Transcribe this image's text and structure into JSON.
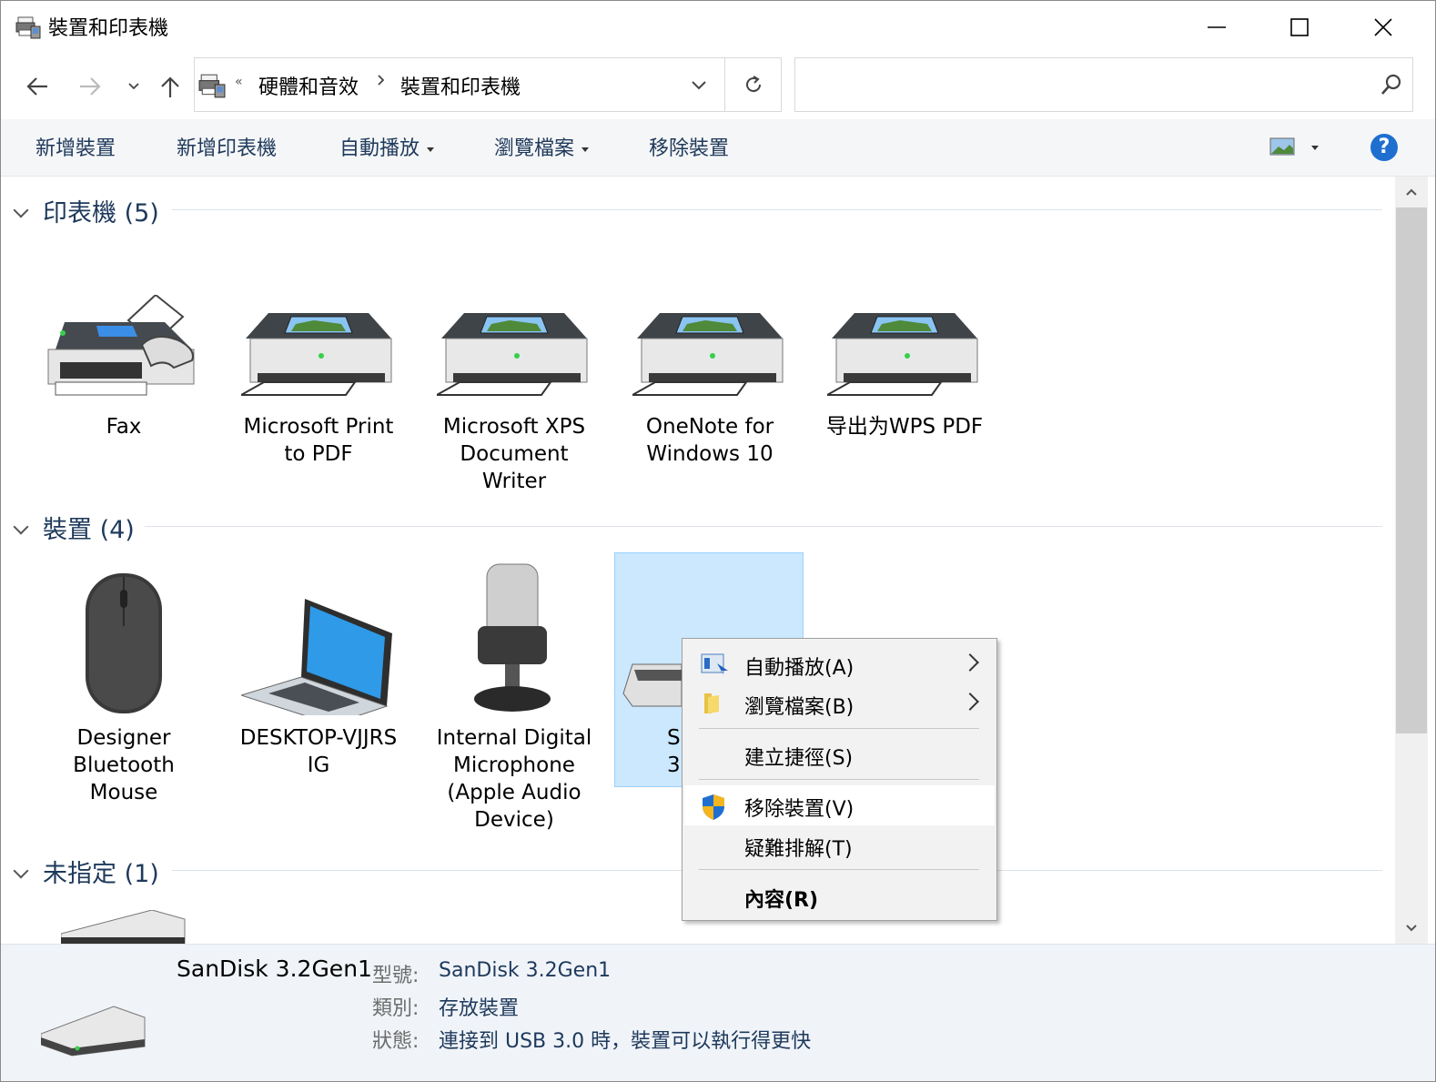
{
  "window": {
    "title": "裝置和印表機"
  },
  "nav": {
    "breadcrumb_prefix": "«",
    "breadcrumb": [
      "硬體和音效",
      "裝置和印表機"
    ],
    "search_placeholder": ""
  },
  "toolbar": {
    "items": [
      {
        "label": "新增裝置"
      },
      {
        "label": "新增印表機"
      },
      {
        "label": "自動播放"
      },
      {
        "label": "瀏覽檔案"
      },
      {
        "label": "移除裝置"
      }
    ],
    "help": "?"
  },
  "groups": {
    "printers": {
      "title": "印表機 (5)"
    },
    "devices": {
      "title": "裝置 (4)"
    },
    "unspecified": {
      "title": "未指定 (1)"
    }
  },
  "printers": [
    {
      "line1": "Fax",
      "line2": "",
      "line3": ""
    },
    {
      "line1": "Microsoft Print",
      "line2": "to PDF",
      "line3": ""
    },
    {
      "line1": "Microsoft XPS",
      "line2": "Document",
      "line3": "Writer"
    },
    {
      "line1": "OneNote for",
      "line2": "Windows 10",
      "line3": ""
    },
    {
      "line1": "导出为WPS PDF",
      "line2": "",
      "line3": ""
    }
  ],
  "devices": [
    {
      "line1": "Designer",
      "line2": "Bluetooth",
      "line3": "Mouse",
      "line4": ""
    },
    {
      "line1": "DESKTOP-VJJRS",
      "line2": "IG",
      "line3": "",
      "line4": ""
    },
    {
      "line1": "Internal Digital",
      "line2": "Microphone",
      "line3": "(Apple Audio",
      "line4": "Device)"
    },
    {
      "line1": "S",
      "line2": "3.",
      "line3": "",
      "line4": ""
    }
  ],
  "context_menu": {
    "items": [
      {
        "label": "自動播放(A)"
      },
      {
        "label": "瀏覽檔案(B)"
      },
      {
        "label": "建立捷徑(S)"
      },
      {
        "label": "移除裝置(V)"
      },
      {
        "label": "疑難排解(T)"
      },
      {
        "label": "內容(R)"
      }
    ]
  },
  "details": {
    "name": "SanDisk 3.2Gen1",
    "model_label": "型號:",
    "model_value": "SanDisk 3.2Gen1",
    "category_label": "類別:",
    "category_value": "存放裝置",
    "status_label": "狀態:",
    "status_value": "連接到 USB 3.0 時，裝置可以執行得更快"
  }
}
